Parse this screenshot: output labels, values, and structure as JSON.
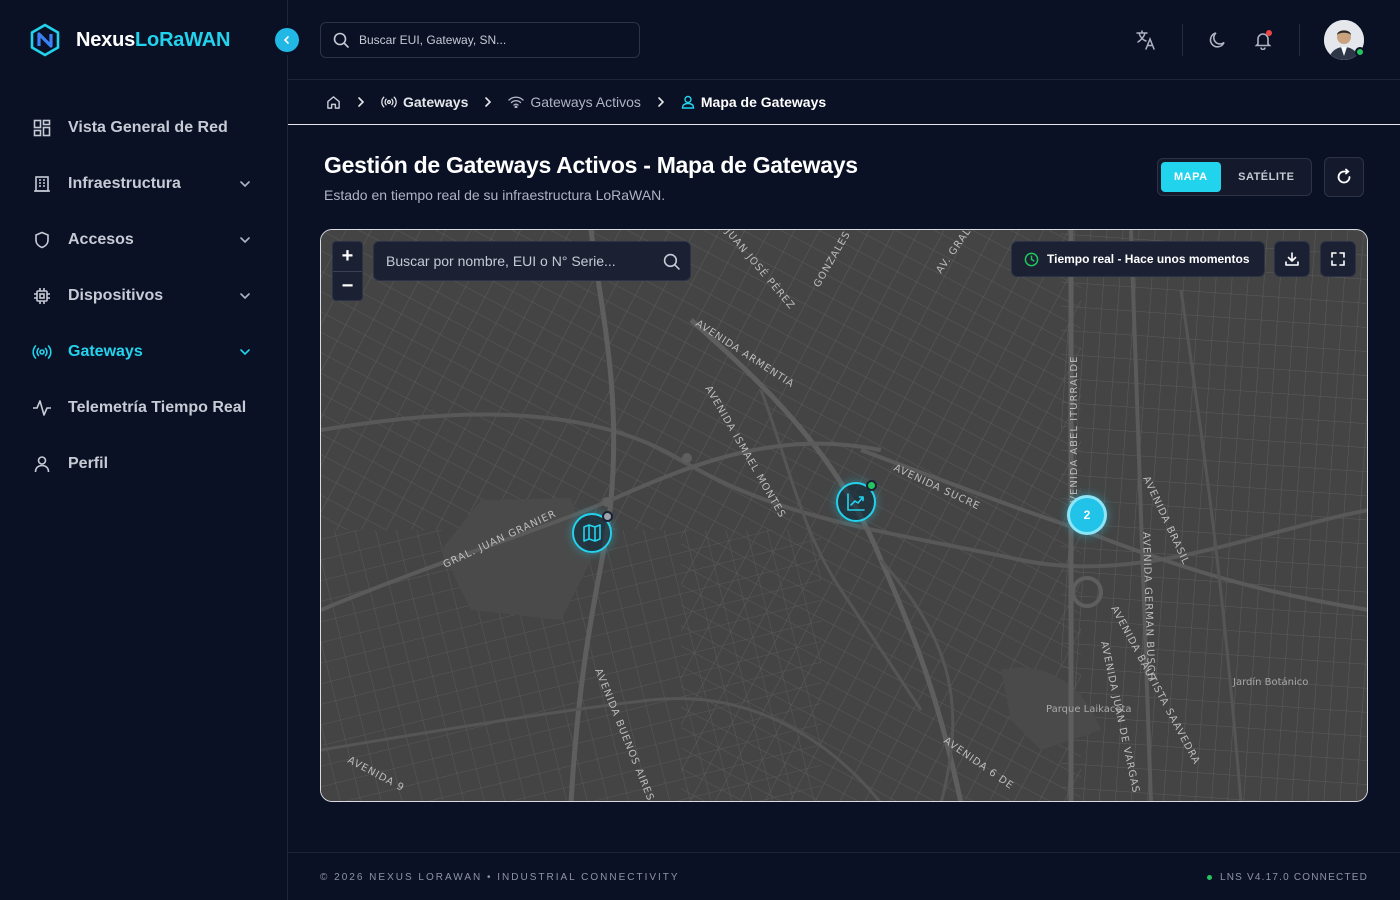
{
  "brand": {
    "name_part1": "Nexus",
    "name_part2": "LoRaWAN"
  },
  "sidebar": {
    "items": [
      {
        "label": "Vista General de Red",
        "icon": "grid-icon",
        "has_chevron": false,
        "active": false
      },
      {
        "label": "Infraestructura",
        "icon": "building-icon",
        "has_chevron": true,
        "active": false
      },
      {
        "label": "Accesos",
        "icon": "shield-icon",
        "has_chevron": true,
        "active": false
      },
      {
        "label": "Dispositivos",
        "icon": "chip-icon",
        "has_chevron": true,
        "active": false
      },
      {
        "label": "Gateways",
        "icon": "radio-icon",
        "has_chevron": true,
        "active": true
      },
      {
        "label": "Telemetría Tiempo Real",
        "icon": "activity-icon",
        "has_chevron": false,
        "active": false
      },
      {
        "label": "Perfil",
        "icon": "user-icon",
        "has_chevron": false,
        "active": false
      }
    ]
  },
  "topbar": {
    "search_placeholder": "Buscar EUI, Gateway, SN...",
    "icons": [
      "translate-icon",
      "moon-icon",
      "bell-icon"
    ]
  },
  "breadcrumb": {
    "items": [
      {
        "label": "",
        "icon": "home-icon"
      },
      {
        "label": "Gateways",
        "icon": "radio-icon"
      },
      {
        "label": "Gateways Activos",
        "icon": "wifi-icon"
      },
      {
        "label": "Mapa de Gateways",
        "icon": "user-pin-icon"
      }
    ]
  },
  "page": {
    "title": "Gestión de Gateways Activos - Mapa de Gateways",
    "subtitle": "Estado en tiempo real de su infraestructura LoRaWAN."
  },
  "view_toggle": {
    "options": [
      "MAPA",
      "SATÉLITE"
    ],
    "selected": "MAPA"
  },
  "map": {
    "zoom_in": "+",
    "zoom_out": "−",
    "search_placeholder": "Buscar por nombre, EUI o N° Serie...",
    "realtime_label": "Tiempo real - Hace unos momentos",
    "cluster_count": "2",
    "street_labels": [
      "AVENIDA ARMENTIA",
      "AVENIDA ISMAEL MONTES",
      "AVENIDA SUCRE",
      "GRAL. JUAN GRANIER",
      "AVENIDA ABEL ITURRALDE",
      "AVENIDA BRASIL",
      "AVENIDA GERMAN BUSCH",
      "AVENIDA BAUTISTA SAAVEDRA",
      "AVENIDA JUAN DE VARGAS",
      "AVENIDA BUENOS AIRES",
      "AVENIDA 9",
      "AVENIDA 6 DE",
      "JUAN JOSÉ PÉREZ",
      "GONZALES",
      "AV. GRAL"
    ],
    "place_labels": [
      "Parque Laikacota",
      "Jardín Botánico"
    ],
    "markers": [
      {
        "icon": "map-icon",
        "status_color": "#9ca3af"
      },
      {
        "icon": "chart-icon",
        "status_color": "#22c55e"
      }
    ]
  },
  "footer": {
    "left": "© 2026 NEXUS LORAWAN • INDUSTRIAL CONNECTIVITY",
    "right": "LNS V4.17.0 CONNECTED"
  },
  "colors": {
    "accent": "#22d3ee",
    "background": "#0b1124",
    "success": "#22c55e",
    "danger": "#ef4444"
  }
}
